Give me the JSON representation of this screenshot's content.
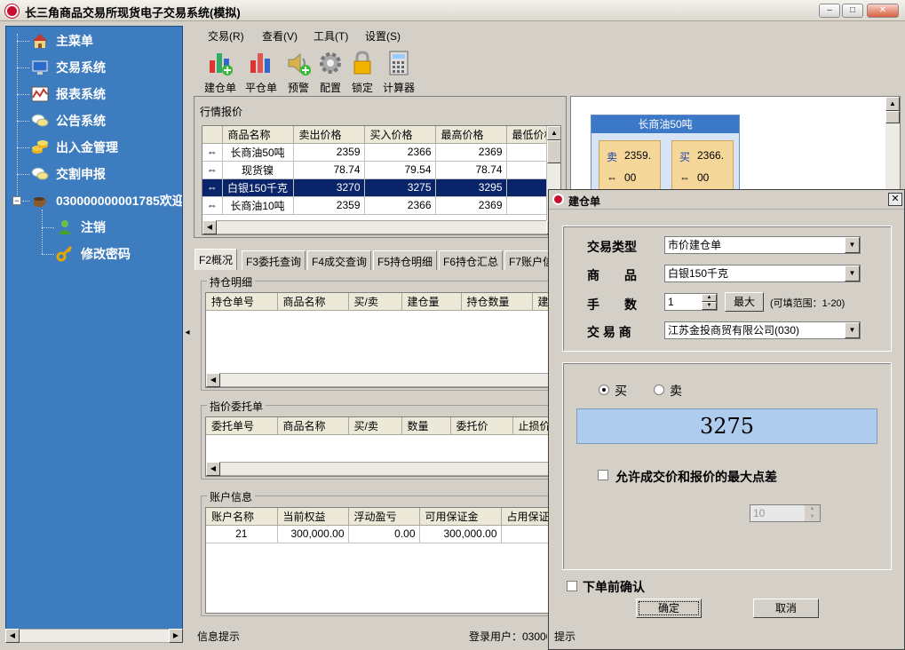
{
  "window": {
    "title": "长三角商品交易所现货电子交易系统(模拟)",
    "min": "–",
    "max": "□",
    "close": "✕"
  },
  "tree": {
    "items": [
      {
        "label": "主菜单",
        "icon": "home-icon"
      },
      {
        "label": "交易系统",
        "icon": "monitor-icon"
      },
      {
        "label": "报表系统",
        "icon": "chart-icon"
      },
      {
        "label": "公告系统",
        "icon": "speech-icon"
      },
      {
        "label": "出入金管理",
        "icon": "coins-icon"
      },
      {
        "label": "交割申报",
        "icon": "speech-icon"
      },
      {
        "label": "030000000001785欢迎",
        "icon": "coffee-icon"
      }
    ],
    "subitems": [
      {
        "label": "注销",
        "icon": "user-icon"
      },
      {
        "label": "修改密码",
        "icon": "key-icon"
      }
    ],
    "collapse_glyph": "−"
  },
  "menu": [
    "交易(R)",
    "查看(V)",
    "工具(T)",
    "设置(S)"
  ],
  "toolbar": [
    "建仓单",
    "平仓单",
    "预警",
    "配置",
    "锁定",
    "计算器"
  ],
  "quotes": {
    "title": "行情报价",
    "columns": [
      "商品名称",
      "卖出价格",
      "买入价格",
      "最高价格",
      "最低价格"
    ],
    "rows": [
      [
        "长商油50吨",
        "2359",
        "2366",
        "2369",
        ""
      ],
      [
        "现货镍",
        "78.74",
        "79.54",
        "78.74",
        ""
      ],
      [
        "白银150千克",
        "3270",
        "3275",
        "3295",
        ""
      ],
      [
        "长商油10吨",
        "2359",
        "2366",
        "2369",
        ""
      ]
    ]
  },
  "quote_card": {
    "name": "长商油50吨",
    "sell_label": "卖",
    "sell": "2359.",
    "buy_label": "买",
    "buy": "2366.",
    "sell_sub": "00",
    "buy_sub": "00"
  },
  "tabs": [
    "F2概况",
    "F3委托查询",
    "F4成交查询",
    "F5持仓明细",
    "F6持仓汇总",
    "F7账户信"
  ],
  "positions": {
    "title": "持仓明细",
    "columns": [
      "持仓单号",
      "商品名称",
      "买/卖",
      "建仓量",
      "持仓数量",
      "建"
    ]
  },
  "orders": {
    "title": "指价委托单",
    "columns": [
      "委托单号",
      "商品名称",
      "买/卖",
      "数量",
      "委托价",
      "止损价"
    ]
  },
  "account": {
    "title": "账户信息",
    "columns": [
      "账户名称",
      "当前权益",
      "浮动盈亏",
      "可用保证金",
      "占用保证"
    ],
    "row": [
      "21",
      "300,000.00",
      "0.00",
      "300,000.00",
      ""
    ]
  },
  "status": {
    "info": "信息提示",
    "login": "登录用户：03000",
    "hint": "提示"
  },
  "dialog": {
    "title": "建仓单",
    "trade_type_label": "交易类型",
    "trade_type": "市价建仓单",
    "goods_label": "商　　品",
    "goods": "白银150千克",
    "qty_label": "手　　数",
    "qty": "1",
    "max_btn": "最大",
    "range": "(可填范围：1-20)",
    "dealer_label": "交 易 商",
    "dealer": "江苏金投商贸有限公司(030)",
    "buy_label": "买",
    "sell_label": "卖",
    "price": "3275",
    "allow_diff_label": "允许成交价和报价的最大点差",
    "diff_value": "10",
    "confirm_label": "下单前确认",
    "ok": "确定",
    "cancel": "取消"
  }
}
